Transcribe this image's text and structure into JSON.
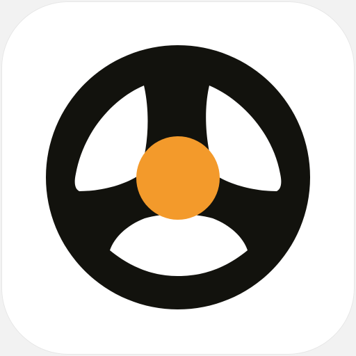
{
  "app_icon": {
    "glyph": "steering-wheel-icon",
    "colors": {
      "tile": "#ffffff",
      "wheel": "#12120d",
      "hub": "#f39a2b",
      "background": "#f2f2f2"
    }
  }
}
